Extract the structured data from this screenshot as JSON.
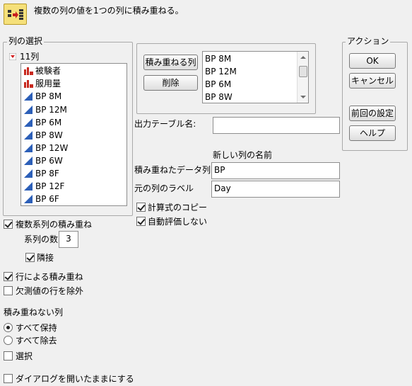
{
  "header": {
    "icon": "stack-columns-icon",
    "instruction": "複数の列の値を1つの列に積み重ねる。"
  },
  "column_select": {
    "title": "列の選択",
    "count_label": "11列",
    "columns": [
      {
        "name": "被験者",
        "type": "nominal",
        "icon": "nominal-bar-icon"
      },
      {
        "name": "服用量",
        "type": "nominal",
        "icon": "nominal-bar-icon"
      },
      {
        "name": "BP 8M",
        "type": "continuous",
        "icon": "continuous-triangle-icon"
      },
      {
        "name": "BP 12M",
        "type": "continuous",
        "icon": "continuous-triangle-icon"
      },
      {
        "name": "BP 6M",
        "type": "continuous",
        "icon": "continuous-triangle-icon"
      },
      {
        "name": "BP 8W",
        "type": "continuous",
        "icon": "continuous-triangle-icon"
      },
      {
        "name": "BP 12W",
        "type": "continuous",
        "icon": "continuous-triangle-icon"
      },
      {
        "name": "BP 6W",
        "type": "continuous",
        "icon": "continuous-triangle-icon"
      },
      {
        "name": "BP 8F",
        "type": "continuous",
        "icon": "continuous-triangle-icon"
      },
      {
        "name": "BP 12F",
        "type": "continuous",
        "icon": "continuous-triangle-icon"
      },
      {
        "name": "BP 6F",
        "type": "continuous",
        "icon": "continuous-triangle-icon"
      }
    ]
  },
  "stack": {
    "stack_button": "積み重ねる列",
    "remove_button": "削除",
    "stacked_columns": [
      "BP 8M",
      "BP 12M",
      "BP 6M",
      "BP 8W"
    ]
  },
  "output": {
    "table_name_label": "出力テーブル名:",
    "table_name_value": "",
    "new_col_heading": "新しい列の名前",
    "stacked_data_label": "積み重ねたデータ列",
    "stacked_data_value": "BP",
    "source_label_label": "元の列のラベル",
    "source_label_value": "Day",
    "copy_formula": {
      "label": "計算式のコピー",
      "checked": true
    },
    "no_auto_eval": {
      "label": "自動評価しない",
      "checked": true
    }
  },
  "actions": {
    "title": "アクション",
    "ok": "OK",
    "cancel": "キャンセル",
    "recall": "前回の設定",
    "help": "ヘルプ"
  },
  "options": {
    "multiple_series": {
      "label": "複数系列の積み重ね",
      "checked": true
    },
    "series_count_label": "系列の数",
    "series_count_value": "3",
    "contiguous": {
      "label": "隣接",
      "checked": true
    },
    "stack_by_row": {
      "label": "行による積み重ね",
      "checked": true
    },
    "drop_missing": {
      "label": "欠測値の行を除外",
      "checked": false
    },
    "non_stacked_heading": "積み重ねない列",
    "keep_all": {
      "label": "すべて保持",
      "selected": true
    },
    "drop_all": {
      "label": "すべて除去",
      "selected": false
    },
    "select": {
      "label": "選択",
      "checked": false
    },
    "keep_dialog_open": {
      "label": "ダイアログを開いたままにする",
      "checked": false
    }
  },
  "colors": {
    "nominal": "#c8281e",
    "continuous": "#2c5fb8",
    "count_triangle": "#d21e1e"
  }
}
